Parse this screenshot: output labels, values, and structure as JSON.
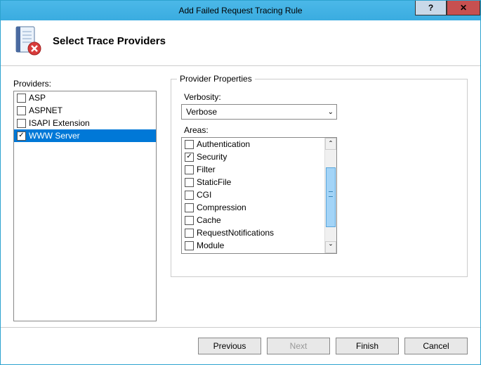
{
  "window": {
    "title": "Add Failed Request Tracing Rule"
  },
  "header": {
    "title": "Select Trace Providers"
  },
  "providers": {
    "label": "Providers:",
    "items": [
      {
        "label": "ASP",
        "checked": false,
        "selected": false
      },
      {
        "label": "ASPNET",
        "checked": false,
        "selected": false
      },
      {
        "label": "ISAPI Extension",
        "checked": false,
        "selected": false
      },
      {
        "label": "WWW Server",
        "checked": true,
        "selected": true
      }
    ]
  },
  "properties": {
    "group_title": "Provider Properties",
    "verbosity_label": "Verbosity:",
    "verbosity_value": "Verbose",
    "areas_label": "Areas:",
    "areas": [
      {
        "label": "Authentication",
        "checked": false
      },
      {
        "label": "Security",
        "checked": true
      },
      {
        "label": "Filter",
        "checked": false
      },
      {
        "label": "StaticFile",
        "checked": false
      },
      {
        "label": "CGI",
        "checked": false
      },
      {
        "label": "Compression",
        "checked": false
      },
      {
        "label": "Cache",
        "checked": false
      },
      {
        "label": "RequestNotifications",
        "checked": false
      },
      {
        "label": "Module",
        "checked": false
      }
    ]
  },
  "buttons": {
    "previous": "Previous",
    "next": "Next",
    "finish": "Finish",
    "cancel": "Cancel"
  },
  "glyphs": {
    "check": "✓",
    "help": "?",
    "close": "✕",
    "down": "ˇ",
    "up": "ˆ",
    "dropdown": "⌄"
  }
}
